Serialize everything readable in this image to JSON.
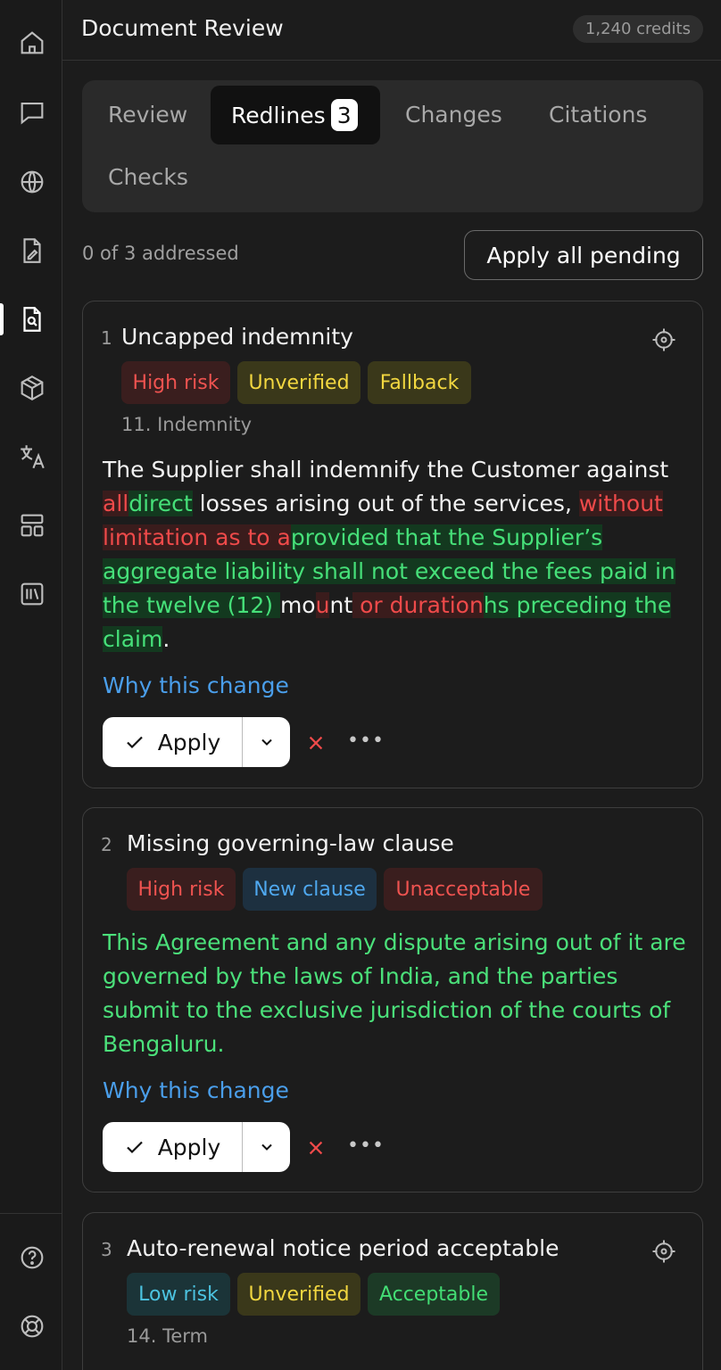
{
  "header": {
    "title": "Document Review",
    "credits": "1,240 credits"
  },
  "tabs": [
    {
      "label": "Review"
    },
    {
      "label": "Redlines",
      "badge": "3",
      "active": true
    },
    {
      "label": "Changes"
    },
    {
      "label": "Citations"
    },
    {
      "label": "Checks"
    }
  ],
  "status": {
    "addressed": "0 of 3 addressed",
    "apply_all_label": "Apply all pending"
  },
  "sidebar": {
    "items": [
      {
        "icon": "home-icon"
      },
      {
        "icon": "chat-icon"
      },
      {
        "icon": "globe-icon"
      },
      {
        "icon": "document-edit-icon"
      },
      {
        "icon": "document-search-icon",
        "active": true
      },
      {
        "icon": "cube-icon"
      },
      {
        "icon": "translate-icon"
      },
      {
        "icon": "layout-icon"
      },
      {
        "icon": "library-icon"
      }
    ],
    "bottom": [
      {
        "icon": "help-icon"
      },
      {
        "icon": "support-icon"
      }
    ]
  },
  "cards": [
    {
      "number": "1",
      "title": "Uncapped indemnity",
      "tags": [
        "High risk",
        "Unverified",
        "Fallback"
      ],
      "section": "11. Indemnity",
      "segments": [
        {
          "t": "The Supplier shall indemnify the Customer against ",
          "k": "plain"
        },
        {
          "t": "all",
          "k": "del"
        },
        {
          "t": "direct",
          "k": "ins"
        },
        {
          "t": " losses arising out of the services, ",
          "k": "plain"
        },
        {
          "t": "without limitation as to a",
          "k": "del"
        },
        {
          "t": "provided that the Supplier’s aggregate liability shall not exceed the fees paid in the twelve (12) ",
          "k": "ins"
        },
        {
          "t": "mo",
          "k": "plain"
        },
        {
          "t": "u",
          "k": "del"
        },
        {
          "t": "nt",
          "k": "plain"
        },
        {
          "t": " or duration",
          "k": "del"
        },
        {
          "t": "hs preceding the claim",
          "k": "ins"
        },
        {
          "t": ".",
          "k": "plain"
        }
      ],
      "why_label": "Why this change",
      "apply_label": "Apply"
    },
    {
      "number": "2",
      "title": "Missing governing-law clause",
      "tags": [
        "High risk",
        "New clause",
        "Unacceptable"
      ],
      "text": "This Agreement and any dispute arising out of it are governed by the laws of India, and the parties submit to the exclusive jurisdiction of the courts of Bengaluru.",
      "why_label": "Why this change",
      "apply_label": "Apply"
    },
    {
      "number": "3",
      "title": "Auto-renewal notice period acceptable",
      "tags": [
        "Low risk",
        "Unverified",
        "Acceptable"
      ],
      "section": "14. Term"
    }
  ],
  "colors": {
    "background": "#1c1c1c",
    "deleted_text": "#ef4a4a",
    "inserted_text": "#46e079",
    "link": "#4a9eea"
  }
}
